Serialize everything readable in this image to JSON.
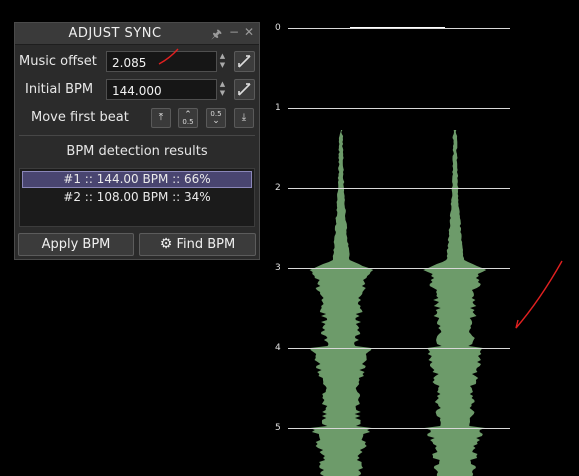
{
  "panel": {
    "title": "ADJUST SYNC",
    "music_offset": {
      "label": "Music offset",
      "value": "2.085"
    },
    "initial_bpm": {
      "label": "Initial BPM",
      "value": "144.000"
    },
    "move_first_beat": {
      "label": "Move first beat",
      "half_label": "0.5"
    },
    "detection": {
      "title": "BPM detection results",
      "results": [
        "#1 :: 144.00 BPM :: 66%",
        "#2 :: 108.00 BPM :: 34%"
      ]
    },
    "apply_label": "Apply BPM",
    "find_label": "Find BPM"
  },
  "timeline": {
    "measures": [
      "0",
      "1",
      "2",
      "3",
      "4",
      "5"
    ]
  },
  "colors": {
    "waveform": "#6d9b6a",
    "selection": "#494570",
    "annotation": "#e02020"
  }
}
